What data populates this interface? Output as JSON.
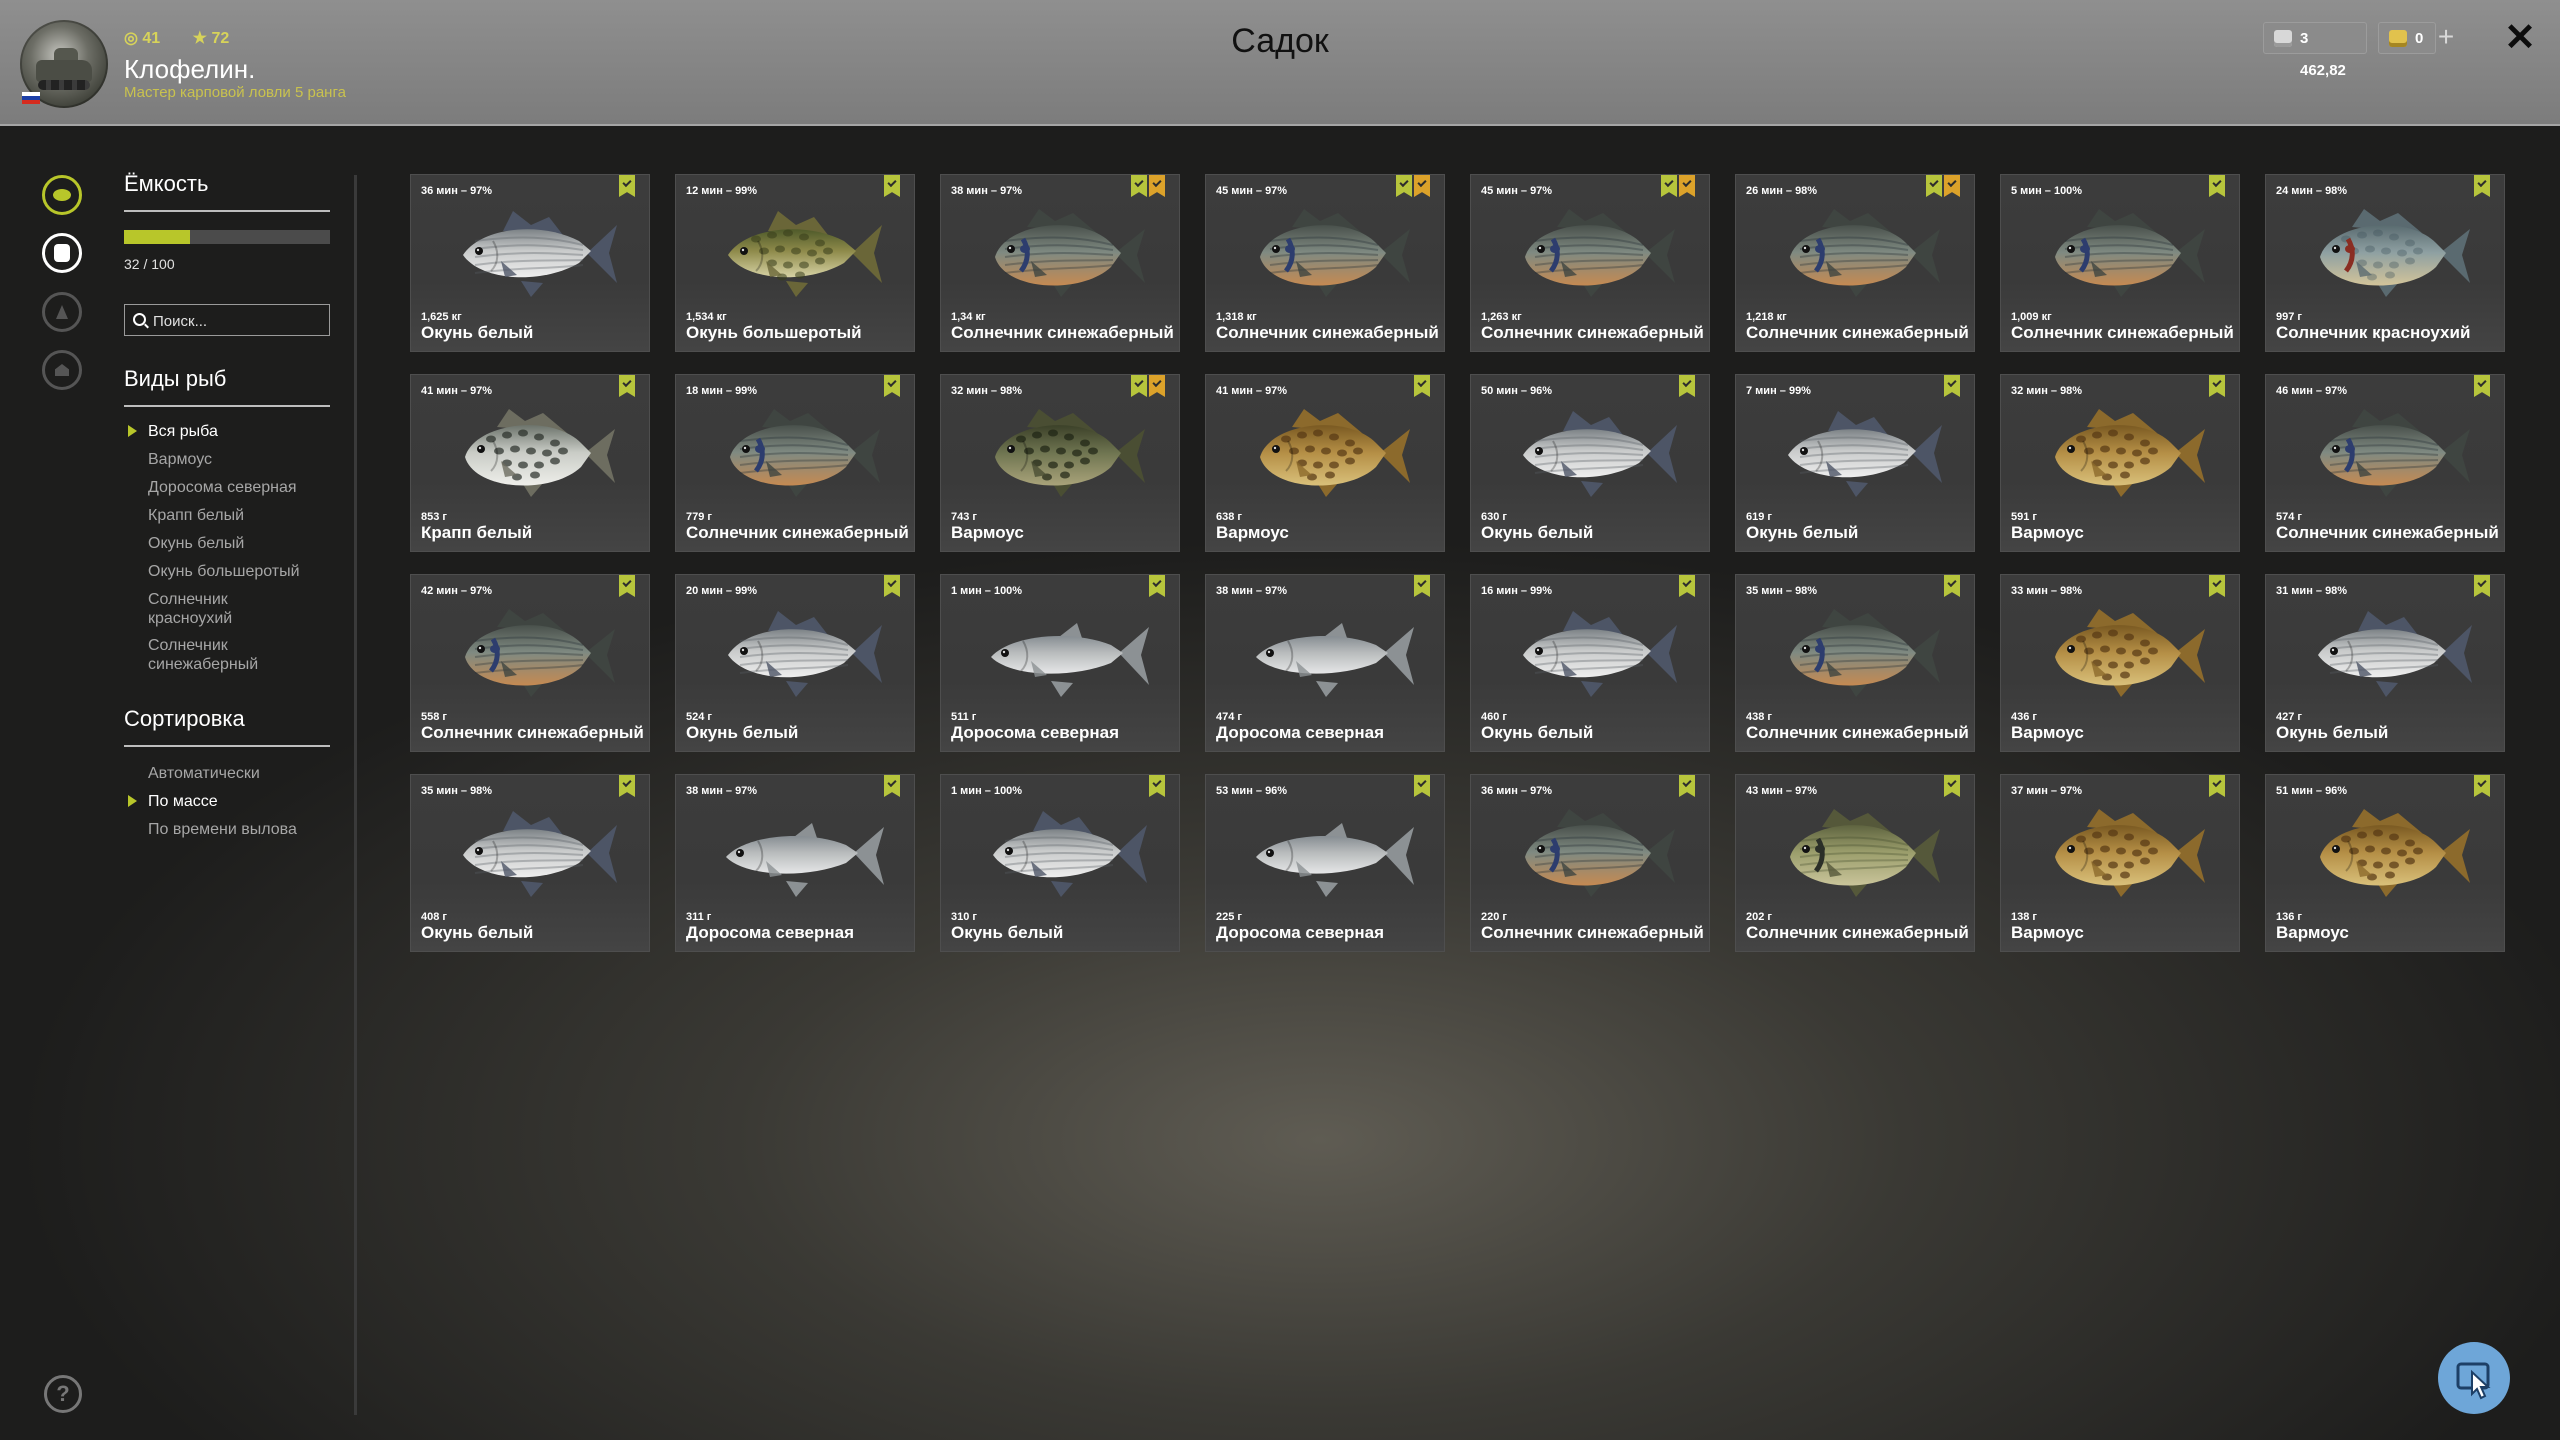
{
  "header": {
    "title": "Садок",
    "player": {
      "level_icon": "circle-level-icon",
      "level": "41",
      "stars_icon": "star-icon",
      "stars": "72",
      "name": "Клофелин.",
      "rank": "Мастер карповой ловли 5 ранга"
    },
    "currency": {
      "silver": "3 462,82",
      "gold": "0"
    },
    "close_label": "✕",
    "plus_label": "+"
  },
  "sidebar": {
    "capacity": {
      "title": "Ёмкость",
      "text": "32 / 100",
      "fraction": 0.32
    },
    "search_placeholder": "Поиск...",
    "species": {
      "title": "Виды рыб",
      "items": [
        "Вся рыба",
        "Вармоус",
        "Доросома северная",
        "Крапп белый",
        "Окунь белый",
        "Окунь большеротый",
        "Солнечник красноухий",
        "Солнечник синежаберный"
      ],
      "active_index": 0
    },
    "sort": {
      "title": "Сортировка",
      "items": [
        "Автоматически",
        "По массе",
        "По времени вылова"
      ],
      "active_index": 1
    }
  },
  "colors": {
    "accent": "#b8c62a",
    "flag_green": "#b7c53c",
    "flag_yellow": "#dca22a"
  },
  "fish_cards": [
    {
      "time": "36 мин – 97%",
      "weight": "1,625 кг",
      "name": "Окунь белый",
      "flags": [
        "g"
      ],
      "kind": "white"
    },
    {
      "time": "12 мин – 99%",
      "weight": "1,534 кг",
      "name": "Окунь большеротый",
      "flags": [
        "g"
      ],
      "kind": "bass"
    },
    {
      "time": "38 мин – 97%",
      "weight": "1,34 кг",
      "name": "Солнечник синежаберный",
      "flags": [
        "g",
        "y"
      ],
      "kind": "bluegill"
    },
    {
      "time": "45 мин – 97%",
      "weight": "1,318 кг",
      "name": "Солнечник синежаберный",
      "flags": [
        "g",
        "y"
      ],
      "kind": "bluegill"
    },
    {
      "time": "45 мин – 97%",
      "weight": "1,263 кг",
      "name": "Солнечник синежаберный",
      "flags": [
        "g",
        "y"
      ],
      "kind": "bluegill"
    },
    {
      "time": "26 мин – 98%",
      "weight": "1,218 кг",
      "name": "Солнечник синежаберный",
      "flags": [
        "g",
        "y"
      ],
      "kind": "bluegill"
    },
    {
      "time": "5 мин – 100%",
      "weight": "1,009 кг",
      "name": "Солнечник синежаберный",
      "flags": [
        "g"
      ],
      "kind": "bluegill"
    },
    {
      "time": "24 мин – 98%",
      "weight": "997 г",
      "name": "Солнечник красноухий",
      "flags": [
        "g"
      ],
      "kind": "redear"
    },
    {
      "time": "41 мин – 97%",
      "weight": "853 г",
      "name": "Крапп белый",
      "flags": [
        "g"
      ],
      "kind": "crappie"
    },
    {
      "time": "18 мин – 99%",
      "weight": "779 г",
      "name": "Солнечник синежаберный",
      "flags": [
        "g"
      ],
      "kind": "bluegill"
    },
    {
      "time": "32 мин – 98%",
      "weight": "743 г",
      "name": "Вармоус",
      "flags": [
        "g",
        "y"
      ],
      "kind": "warmouth_dark"
    },
    {
      "time": "41 мин – 97%",
      "weight": "638 г",
      "name": "Вармоус",
      "flags": [
        "g"
      ],
      "kind": "warmouth"
    },
    {
      "time": "50 мин – 96%",
      "weight": "630 г",
      "name": "Окунь белый",
      "flags": [
        "g"
      ],
      "kind": "white"
    },
    {
      "time": "7 мин – 99%",
      "weight": "619 г",
      "name": "Окунь белый",
      "flags": [
        "g"
      ],
      "kind": "white"
    },
    {
      "time": "32 мин – 98%",
      "weight": "591 г",
      "name": "Вармоус",
      "flags": [
        "g"
      ],
      "kind": "warmouth"
    },
    {
      "time": "46 мин – 97%",
      "weight": "574 г",
      "name": "Солнечник синежаберный",
      "flags": [
        "g"
      ],
      "kind": "bluegill"
    },
    {
      "time": "42 мин – 97%",
      "weight": "558 г",
      "name": "Солнечник синежаберный",
      "flags": [
        "g"
      ],
      "kind": "bluegill"
    },
    {
      "time": "20 мин – 99%",
      "weight": "524 г",
      "name": "Окунь белый",
      "flags": [
        "g"
      ],
      "kind": "white"
    },
    {
      "time": "1 мин – 100%",
      "weight": "511 г",
      "name": "Доросома северная",
      "flags": [
        "g"
      ],
      "kind": "shad"
    },
    {
      "time": "38 мин – 97%",
      "weight": "474 г",
      "name": "Доросома северная",
      "flags": [
        "g"
      ],
      "kind": "shad"
    },
    {
      "time": "16 мин – 99%",
      "weight": "460 г",
      "name": "Окунь белый",
      "flags": [
        "g"
      ],
      "kind": "white"
    },
    {
      "time": "35 мин – 98%",
      "weight": "438 г",
      "name": "Солнечник синежаберный",
      "flags": [
        "g"
      ],
      "kind": "bluegill"
    },
    {
      "time": "33 мин – 98%",
      "weight": "436 г",
      "name": "Вармоус",
      "flags": [
        "g"
      ],
      "kind": "warmouth"
    },
    {
      "time": "31 мин – 98%",
      "weight": "427 г",
      "name": "Окунь белый",
      "flags": [
        "g"
      ],
      "kind": "white"
    },
    {
      "time": "35 мин – 98%",
      "weight": "408 г",
      "name": "Окунь белый",
      "flags": [
        "g"
      ],
      "kind": "white"
    },
    {
      "time": "38 мин – 97%",
      "weight": "311 г",
      "name": "Доросома северная",
      "flags": [
        "g"
      ],
      "kind": "shad"
    },
    {
      "time": "1 мин – 100%",
      "weight": "310 г",
      "name": "Окунь белый",
      "flags": [
        "g"
      ],
      "kind": "white"
    },
    {
      "time": "53 мин – 96%",
      "weight": "225 г",
      "name": "Доросома северная",
      "flags": [
        "g"
      ],
      "kind": "shad"
    },
    {
      "time": "36 мин – 97%",
      "weight": "220 г",
      "name": "Солнечник синежаберный",
      "flags": [
        "g"
      ],
      "kind": "bluegill"
    },
    {
      "time": "43 мин – 97%",
      "weight": "202 г",
      "name": "Солнечник синежаберный",
      "flags": [
        "g"
      ],
      "kind": "bluegill_green"
    },
    {
      "time": "37 мин – 97%",
      "weight": "138 г",
      "name": "Вармоус",
      "flags": [
        "g"
      ],
      "kind": "warmouth"
    },
    {
      "time": "51 мин – 96%",
      "weight": "136 г",
      "name": "Вармоус",
      "flags": [
        "g"
      ],
      "kind": "warmouth"
    }
  ],
  "icons": {
    "rail": [
      "fish-icon",
      "keepnet-icon",
      "fire-icon",
      "home-icon"
    ],
    "help": "help-icon",
    "cursor_button": "cursor-icon"
  },
  "help_label": "?"
}
